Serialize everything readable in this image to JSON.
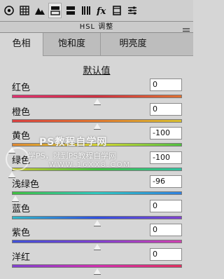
{
  "toolbar": {
    "icons": [
      "aperture-icon",
      "grid-icon",
      "mountains-icon",
      "split-toning-icon",
      "lens-icon",
      "fx-icon",
      "film-icon",
      "sliders-icon"
    ]
  },
  "panel": {
    "title": "HSL 调整"
  },
  "tabs": [
    "色相",
    "饱和度",
    "明亮度"
  ],
  "default_label": "默认值",
  "sliders": [
    {
      "label": "红色",
      "value": "0",
      "gradient": [
        "#e0306f",
        "#d03040",
        "#e07030"
      ],
      "fraction": 0.5
    },
    {
      "label": "橙色",
      "value": "0",
      "gradient": [
        "#d84040",
        "#e07830",
        "#d8c030"
      ],
      "fraction": 0.5
    },
    {
      "label": "黄色",
      "value": "-100",
      "gradient": [
        "#e08830",
        "#d8d830",
        "#50c040"
      ],
      "fraction": 0.0
    },
    {
      "label": "绿色",
      "value": "-100",
      "gradient": [
        "#c8c830",
        "#40c040",
        "#30c0a0"
      ],
      "fraction": 0.0
    },
    {
      "label": "浅绿色",
      "value": "-96",
      "gradient": [
        "#40c040",
        "#30c8c0",
        "#3080e0"
      ],
      "fraction": 0.02
    },
    {
      "label": "蓝色",
      "value": "0",
      "gradient": [
        "#30b8c8",
        "#3050e0",
        "#8040d0"
      ],
      "fraction": 0.5
    },
    {
      "label": "紫色",
      "value": "0",
      "gradient": [
        "#4050d8",
        "#8040d0",
        "#d040b0"
      ],
      "fraction": 0.5
    },
    {
      "label": "洋红",
      "value": "0",
      "gradient": [
        "#8040d0",
        "#d030b0",
        "#e03060"
      ],
      "fraction": 0.5
    }
  ],
  "watermark": {
    "title": "PS教程自学网",
    "subtitle": "学PS，就到PS教程自学网",
    "url": "WWW.16XX8.COM"
  }
}
